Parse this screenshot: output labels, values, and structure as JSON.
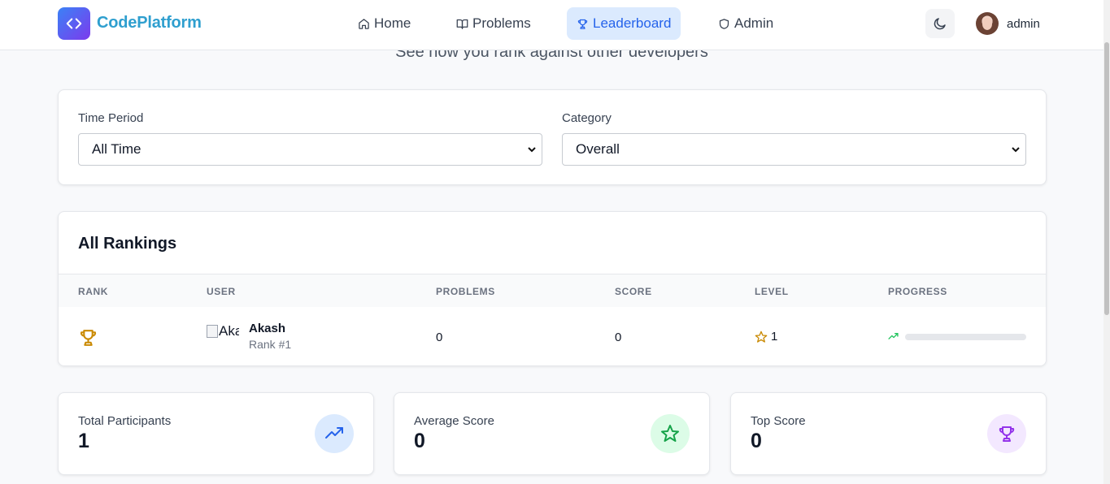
{
  "app": {
    "brand": "CodePlatform"
  },
  "nav": [
    {
      "label": "Home",
      "icon": "home-icon"
    },
    {
      "label": "Problems",
      "icon": "book-icon"
    },
    {
      "label": "Leaderboard",
      "icon": "trophy-icon",
      "active": true
    },
    {
      "label": "Admin",
      "icon": "shield-icon"
    }
  ],
  "header": {
    "user_name": "admin",
    "theme_icon": "moon-icon"
  },
  "page": {
    "subtitle": "See how you rank against other developers"
  },
  "filters": {
    "time_period": {
      "label": "Time Period",
      "value": "All Time"
    },
    "category": {
      "label": "Category",
      "value": "Overall"
    }
  },
  "rankings": {
    "title": "All Rankings",
    "columns": [
      "RANK",
      "USER",
      "PROBLEMS",
      "SCORE",
      "LEVEL",
      "PROGRESS"
    ],
    "rows": [
      {
        "rank_icon": "trophy-icon",
        "avatar_alt": "Akash",
        "name": "Akash",
        "rank_label": "Rank #1",
        "problems": "0",
        "score": "0",
        "level": "1",
        "progress": 0
      }
    ]
  },
  "stats": [
    {
      "label": "Total Participants",
      "value": "1",
      "icon": "trending-up-icon",
      "color": "#2563eb",
      "bg": "#dbeafe"
    },
    {
      "label": "Average Score",
      "value": "0",
      "icon": "star-icon",
      "color": "#16a34a",
      "bg": "#dcfce7"
    },
    {
      "label": "Top Score",
      "value": "0",
      "icon": "trophy-icon",
      "color": "#9333ea",
      "bg": "#f3e8ff"
    }
  ],
  "colors": {
    "accent": "#2563eb",
    "brand_text": "#2f9fcf",
    "trophy_gold": "#ca8a04",
    "star_gold": "#ca8a04",
    "progress_green": "#22c55e"
  }
}
